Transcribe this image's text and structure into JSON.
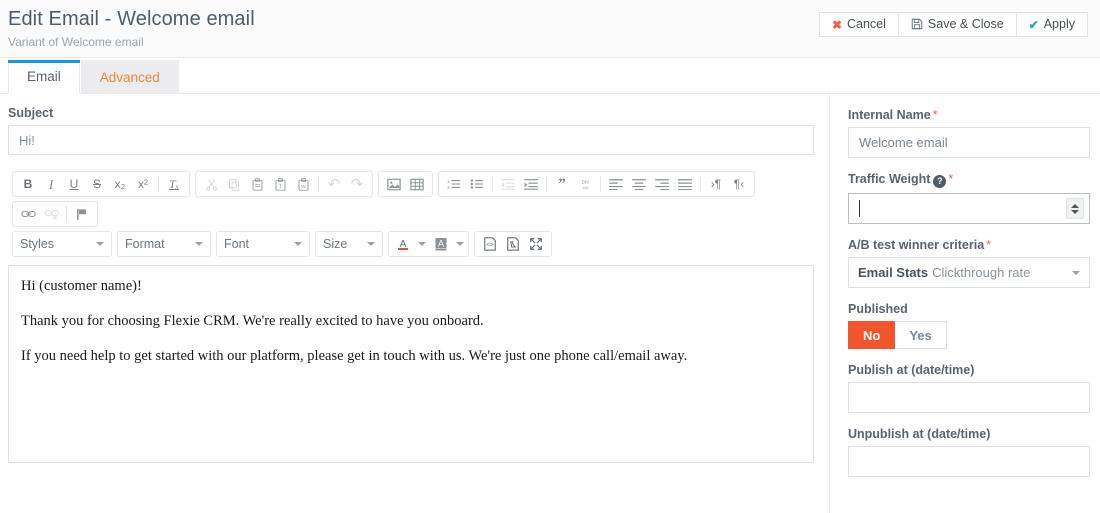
{
  "header": {
    "title": "Edit Email - Welcome email",
    "subtitle": "Variant of Welcome email",
    "actions": [
      {
        "label": "Cancel",
        "icon": "close-icon",
        "glyph": "✖"
      },
      {
        "label": "Save & Close",
        "icon": "floppy-disk-icon",
        "glyph": "💾"
      },
      {
        "label": "Apply",
        "icon": "check-icon",
        "glyph": "✔"
      }
    ]
  },
  "tabs": [
    {
      "label": "Email",
      "active": true
    },
    {
      "label": "Advanced",
      "active": false
    }
  ],
  "main": {
    "subject": {
      "label": "Subject",
      "value": "Hi!"
    },
    "editor": {
      "toolbar_row1": [
        {
          "name": "bold-icon",
          "label": "B",
          "disabled": false
        },
        {
          "name": "italic-icon",
          "label": "I",
          "disabled": false
        },
        {
          "name": "underline-icon",
          "label": "U",
          "disabled": false
        },
        {
          "name": "strikethrough-icon",
          "label": "S",
          "disabled": false
        },
        {
          "name": "subscript-icon",
          "label": "x₂",
          "disabled": false
        },
        {
          "name": "superscript-icon",
          "label": "x²",
          "disabled": false
        },
        {
          "name": "remove-format-icon",
          "label": "Tₓ",
          "disabled": false
        }
      ],
      "toolbar_clipboard": [
        {
          "name": "cut-icon",
          "label": "✂",
          "disabled": true
        },
        {
          "name": "copy-icon",
          "label": "❐",
          "disabled": true
        },
        {
          "name": "paste-icon",
          "label": "📋",
          "disabled": false
        },
        {
          "name": "paste-text-icon",
          "label": "📋",
          "disabled": false
        },
        {
          "name": "paste-word-icon",
          "label": "📋",
          "disabled": false
        },
        {
          "name": "undo-icon",
          "label": "↶",
          "disabled": true
        },
        {
          "name": "redo-icon",
          "label": "↷",
          "disabled": true
        }
      ],
      "toolbar_insert": [
        {
          "name": "image-icon",
          "label": "🖼",
          "disabled": false
        },
        {
          "name": "table-icon",
          "label": "▦",
          "disabled": false
        }
      ],
      "toolbar_paragraph": [
        {
          "name": "numbered-list-icon",
          "disabled": false
        },
        {
          "name": "bulleted-list-icon",
          "disabled": false
        },
        {
          "name": "outdent-icon",
          "disabled": true
        },
        {
          "name": "indent-icon",
          "disabled": false
        },
        {
          "name": "blockquote-icon",
          "disabled": false
        },
        {
          "name": "create-div-icon",
          "disabled": false
        },
        {
          "name": "align-left-icon",
          "disabled": false
        },
        {
          "name": "align-center-icon",
          "disabled": false
        },
        {
          "name": "align-right-icon",
          "disabled": false
        },
        {
          "name": "justify-icon",
          "disabled": false
        },
        {
          "name": "text-direction-ltr-icon",
          "disabled": false
        },
        {
          "name": "text-direction-rtl-icon",
          "disabled": false
        }
      ],
      "toolbar_links": [
        {
          "name": "link-icon",
          "disabled": false
        },
        {
          "name": "unlink-icon",
          "disabled": true
        },
        {
          "name": "anchor-flag-icon",
          "disabled": false
        }
      ],
      "combos": [
        {
          "name": "styles-dropdown",
          "label": "Styles"
        },
        {
          "name": "format-dropdown",
          "label": "Format"
        },
        {
          "name": "font-dropdown",
          "label": "Font"
        },
        {
          "name": "size-dropdown",
          "label": "Size"
        }
      ],
      "toolbar_colors": [
        {
          "name": "text-color-icon",
          "label": "A"
        },
        {
          "name": "background-color-icon",
          "label": "A"
        }
      ],
      "toolbar_tools": [
        {
          "name": "source-code-icon"
        },
        {
          "name": "templates-icon"
        },
        {
          "name": "maximize-icon"
        }
      ],
      "content": [
        "Hi (customer name)!",
        "Thank you for choosing Flexie CRM. We're really excited to have you onboard.",
        "If you need help to get started with our platform, please get in touch with us. We're just one phone call/email away."
      ]
    }
  },
  "sidebar": {
    "internal_name": {
      "label": "Internal Name",
      "required": "*",
      "value": "Welcome email"
    },
    "traffic_weight": {
      "label": "Traffic Weight",
      "help_glyph": "?",
      "required": "*",
      "value": ""
    },
    "ab_criteria": {
      "label": "A/B test winner criteria",
      "required": "*",
      "group": "Email Stats",
      "value": "Clickthrough rate"
    },
    "published": {
      "label": "Published",
      "options": [
        {
          "label": "No",
          "selected": true
        },
        {
          "label": "Yes",
          "selected": false
        }
      ]
    },
    "publish_at": {
      "label": "Publish at (date/time)",
      "value": ""
    },
    "unpublish_at": {
      "label": "Unpublish at (date/time)",
      "value": ""
    }
  },
  "colors": {
    "accent_blue": "#0e9ae0",
    "tab_orange": "#e8893a",
    "danger_red": "#f0614a",
    "toggle_on": "#f2552c",
    "apply_green": "#17b39b"
  }
}
